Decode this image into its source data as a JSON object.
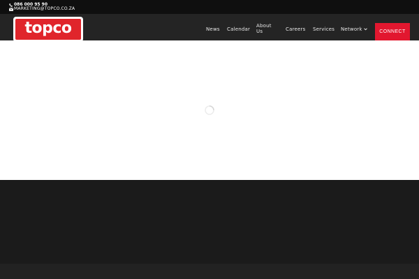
{
  "topbar": {
    "phone": "086 000 95 90",
    "email": "MARKETING@TOPCO.CO.ZA",
    "phone_icon": "phone-icon",
    "email_icon": "envelope-icon"
  },
  "logo": {
    "text": "topco"
  },
  "nav": {
    "items": [
      {
        "label": "News"
      },
      {
        "label": "Calendar"
      },
      {
        "label": "About Us"
      },
      {
        "label": "Careers"
      },
      {
        "label": "Services"
      },
      {
        "label": "Network"
      }
    ],
    "connect_label": "CONNECT"
  },
  "footer": {
    "links": [
      "",
      "",
      "",
      ""
    ]
  },
  "colors": {
    "brand_red": "#e0252b",
    "connect_red": "#e2172f",
    "topbar_bg": "#0f0f0f",
    "nav_bg": "#242424",
    "footer_bg": "#1b1b1b"
  }
}
